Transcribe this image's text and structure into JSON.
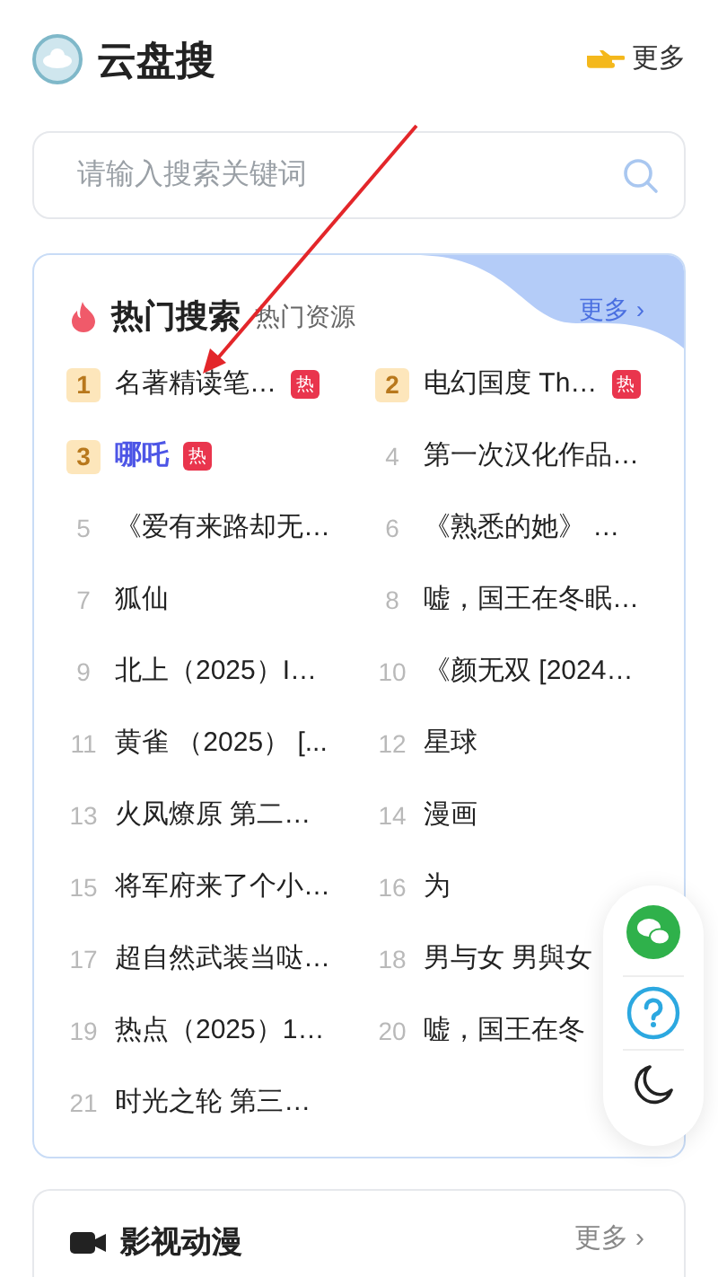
{
  "header": {
    "title": "云盘搜",
    "more": "更多"
  },
  "search": {
    "placeholder": "请输入搜索关键词"
  },
  "hot_section": {
    "title": "热门搜索",
    "subtitle": "热门资源",
    "more": "更多 ›",
    "items": [
      {
        "rank": "1",
        "text": "名著精读笔…",
        "top": true,
        "hot": true,
        "hot_label": "热",
        "selected": false
      },
      {
        "rank": "2",
        "text": "电幻国度 Th…",
        "top": true,
        "hot": true,
        "hot_label": "热",
        "selected": false
      },
      {
        "rank": "3",
        "text": "哪吒",
        "top": true,
        "hot": true,
        "hot_label": "热",
        "selected": true
      },
      {
        "rank": "4",
        "text": "第一次汉化作品…",
        "top": false,
        "hot": false,
        "selected": false
      },
      {
        "rank": "5",
        "text": "《爱有来路却无…",
        "top": false,
        "hot": false,
        "selected": false
      },
      {
        "rank": "6",
        "text": "《熟悉的她》 …",
        "top": false,
        "hot": false,
        "selected": false
      },
      {
        "rank": "7",
        "text": "狐仙",
        "top": false,
        "hot": false,
        "selected": false
      },
      {
        "rank": "8",
        "text": "嘘，国王在冬眠…",
        "top": false,
        "hot": false,
        "selected": false
      },
      {
        "rank": "9",
        "text": "北上（2025）I…",
        "top": false,
        "hot": false,
        "selected": false
      },
      {
        "rank": "10",
        "text": "《颜无双 [2024…",
        "top": false,
        "hot": false,
        "selected": false
      },
      {
        "rank": "11",
        "text": "黄雀 （2025） [...",
        "top": false,
        "hot": false,
        "selected": false
      },
      {
        "rank": "12",
        "text": "星球",
        "top": false,
        "hot": false,
        "selected": false
      },
      {
        "rank": "13",
        "text": "火凤燎原 第二…",
        "top": false,
        "hot": false,
        "selected": false
      },
      {
        "rank": "14",
        "text": "漫画",
        "top": false,
        "hot": false,
        "selected": false
      },
      {
        "rank": "15",
        "text": "将军府来了个小…",
        "top": false,
        "hot": false,
        "selected": false
      },
      {
        "rank": "16",
        "text": "为",
        "top": false,
        "hot": false,
        "selected": false
      },
      {
        "rank": "17",
        "text": "超自然武装当哒…",
        "top": false,
        "hot": false,
        "selected": false
      },
      {
        "rank": "18",
        "text": "男与女 男與女",
        "top": false,
        "hot": false,
        "selected": false
      },
      {
        "rank": "19",
        "text": "热点（2025）1…",
        "top": false,
        "hot": false,
        "selected": false
      },
      {
        "rank": "20",
        "text": "嘘，国王在冬",
        "top": false,
        "hot": false,
        "selected": false
      },
      {
        "rank": "21",
        "text": "时光之轮 第三…",
        "top": false,
        "hot": false,
        "selected": false
      }
    ]
  },
  "video_section": {
    "title": "影视动漫",
    "more": "更多 ›"
  }
}
